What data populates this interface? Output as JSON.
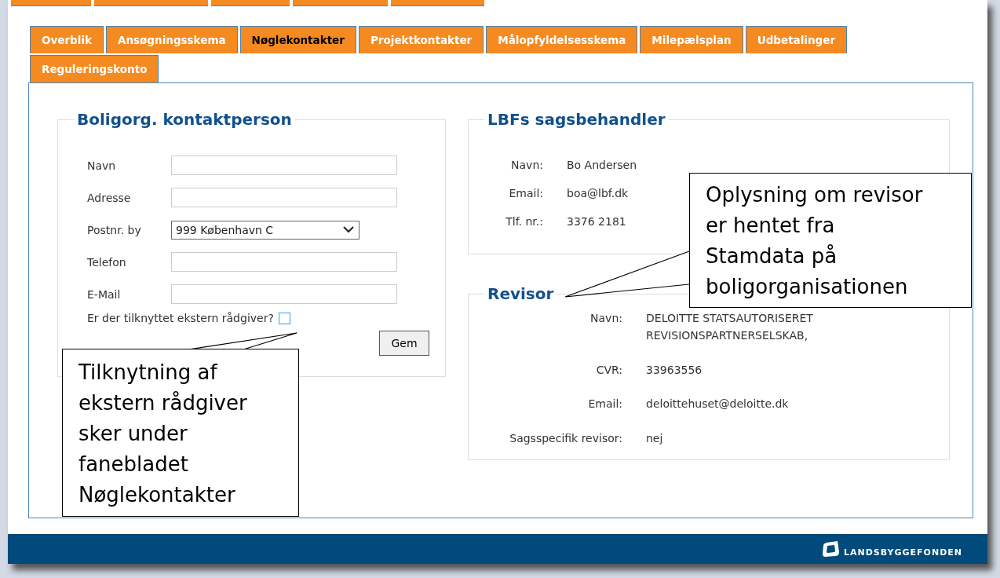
{
  "tabs": [
    {
      "label": "Overblik",
      "selected": false
    },
    {
      "label": "Ansøgningsskema",
      "selected": false
    },
    {
      "label": "Nøglekontakter",
      "selected": true
    },
    {
      "label": "Projektkontakter",
      "selected": false
    },
    {
      "label": "Målopfyldelsesskema",
      "selected": false
    },
    {
      "label": "Milepælsplan",
      "selected": false
    },
    {
      "label": "Udbetalinger",
      "selected": false
    },
    {
      "label": "Reguleringskonto",
      "selected": false
    }
  ],
  "contact_form": {
    "title": "Boligorg. kontaktperson",
    "fields": [
      {
        "label": "Navn",
        "kind": "text"
      },
      {
        "label": "Adresse",
        "kind": "text"
      },
      {
        "label": "Postnr. by",
        "kind": "select",
        "value": "999 København C"
      },
      {
        "label": "Telefon",
        "kind": "text"
      },
      {
        "label": "E-Mail",
        "kind": "text"
      }
    ],
    "question": {
      "label": "Er der tilknyttet ekstern rådgiver?",
      "checked": false
    },
    "save_button": "Gem"
  },
  "caseworker": {
    "title": "LBFs sagsbehandler",
    "rows": [
      {
        "label": "Navn:",
        "value": "Bo Andersen"
      },
      {
        "label": "Email:",
        "value": "boa@lbf.dk"
      },
      {
        "label": "Tlf. nr.:",
        "value": "3376 2181"
      }
    ]
  },
  "auditor": {
    "title": "Revisor",
    "rows": [
      {
        "label": "Navn:",
        "value": "DELOITTE STATSAUTORISERET REVISIONSPARTNERSELSKAB,"
      },
      {
        "label": "CVR:",
        "value": "33963556"
      },
      {
        "label": "Email:",
        "value": "deloittehuset@deloitte.dk"
      },
      {
        "label": "Sagsspecifik revisor:",
        "value": "nej"
      }
    ]
  },
  "callouts": [
    {
      "lines": [
        "Tilknytning af",
        "ekstern rådgiver",
        "sker under",
        "fanebladet",
        "Nøglekontakter"
      ]
    },
    {
      "lines": [
        "Oplysning om revisor",
        "er hentet fra",
        "Stamdata på",
        "boligorganisationen"
      ]
    }
  ],
  "footer": {
    "brand": "LANDSBYGGEFONDEN"
  }
}
